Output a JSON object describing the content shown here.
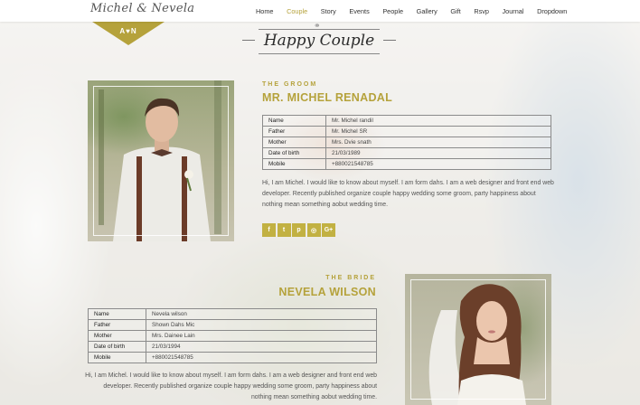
{
  "header": {
    "logo": "Michel & Nevela",
    "nav": [
      "Home",
      "Couple",
      "Story",
      "Events",
      "People",
      "Gallery",
      "Gift",
      "Rsvp",
      "Journal",
      "Dropdown"
    ],
    "active_nav": "Couple"
  },
  "monogram": "A♥N",
  "section": {
    "title": "Happy Couple"
  },
  "groom": {
    "kicker": "THE GROOM",
    "name": "MR. MICHEL RENADAL",
    "details": [
      {
        "label": "Name",
        "value": "Mr. Michel randil"
      },
      {
        "label": "Father",
        "value": "Mr. Michel SR"
      },
      {
        "label": "Mother",
        "value": "Mrs. Dvie snath"
      },
      {
        "label": "Date of birth",
        "value": "21/03/1989"
      },
      {
        "label": "Mobile",
        "value": "+880021548785"
      }
    ],
    "bio": "Hi, I am Michel. I would like to know about myself. I am form dahs. I am a web designer and front end web developer. Recently published organize couple happy wedding some groom, party happiness about nothing mean something aobut wedding time.",
    "socials": [
      {
        "icon": "facebook-icon",
        "glyph": "f"
      },
      {
        "icon": "twitter-icon",
        "glyph": "t"
      },
      {
        "icon": "pinterest-icon",
        "glyph": "p"
      },
      {
        "icon": "instagram-icon",
        "glyph": "◎"
      },
      {
        "icon": "google-plus-icon",
        "glyph": "G+"
      }
    ]
  },
  "bride": {
    "kicker": "THE BRIDE",
    "name": "NEVELA WILSON",
    "details": [
      {
        "label": "Name",
        "value": "Nevela wilson"
      },
      {
        "label": "Father",
        "value": "Shown Dahs Mic"
      },
      {
        "label": "Mother",
        "value": "Mrs. Dainee Lain"
      },
      {
        "label": "Date of birth",
        "value": "21/03/1994"
      },
      {
        "label": "Mobile",
        "value": "+880021548785"
      }
    ],
    "bio": "Hi, I am Michel. I would like to know about myself. I am form dahs. I am a web designer and front end web developer. Recently published organize couple happy wedding some groom, party happiness about nothing mean something aobut wedding time."
  },
  "colors": {
    "accent": "#b5a23b",
    "social_bg": "#c2b142"
  }
}
